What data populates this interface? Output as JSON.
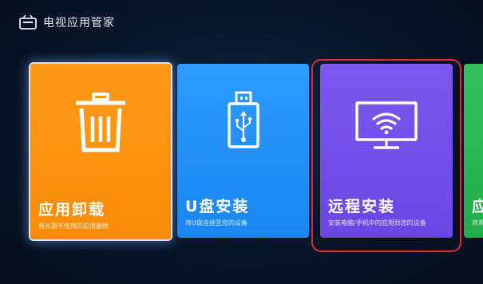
{
  "header": {
    "title": "电视应用管家",
    "icon": "tv-manager-icon"
  },
  "tiles": [
    {
      "label": "应用卸载",
      "desc": "将长期不使用的应用删除",
      "icon": "trash-icon",
      "color": "#f98b08"
    },
    {
      "label": "U盘安装",
      "desc": "将U盘连接至您的设备",
      "icon": "usb-drive-icon",
      "color": "#1a86f1"
    },
    {
      "label": "远程安装",
      "desc": "安装电脑/手机中的应用到您的设备",
      "icon": "tv-wifi-icon",
      "color": "#6a47e4"
    },
    {
      "label": "应",
      "desc": "将系",
      "color": "#22ad4a"
    }
  ],
  "colors": {
    "background": "#081629",
    "highlight_ring": "#e0293a"
  }
}
